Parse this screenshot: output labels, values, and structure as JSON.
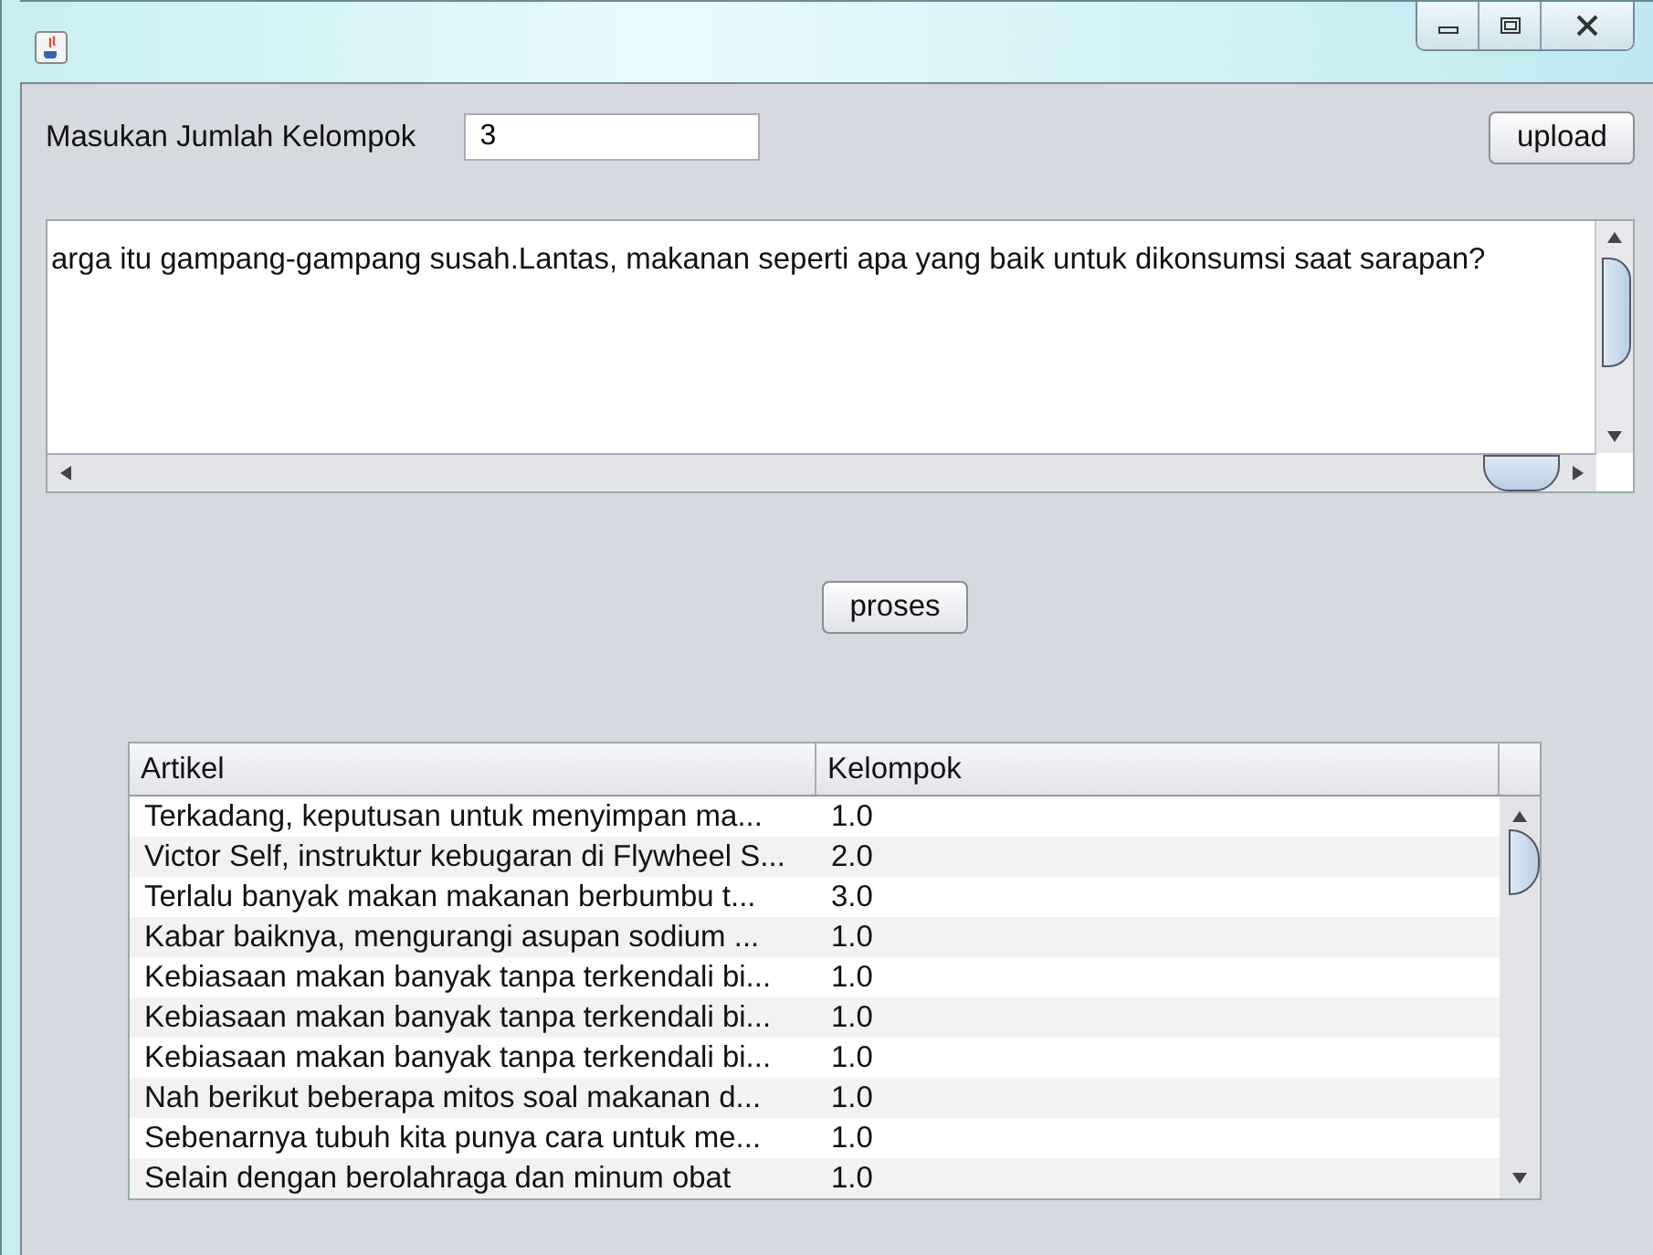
{
  "form": {
    "label": "Masukan Jumlah Kelompok",
    "value": "3",
    "upload_button": "upload"
  },
  "text_area": {
    "value": "arga itu gampang-gampang susah.Lantas, makanan seperti apa yang baik untuk dikonsumsi saat sarapan?"
  },
  "process_button": "proses",
  "table": {
    "columns": [
      "Artikel",
      "Kelompok"
    ],
    "rows": [
      {
        "artikel": "Terkadang, keputusan untuk menyimpan ma...",
        "kelompok": "1.0"
      },
      {
        "artikel": "Victor Self, instruktur kebugaran di Flywheel S...",
        "kelompok": "2.0"
      },
      {
        "artikel": "Terlalu banyak makan makanan berbumbu t...",
        "kelompok": "3.0"
      },
      {
        "artikel": "Kabar baiknya, mengurangi asupan sodium ...",
        "kelompok": "1.0"
      },
      {
        "artikel": "Kebiasaan makan banyak tanpa terkendali bi...",
        "kelompok": "1.0"
      },
      {
        "artikel": "Kebiasaan makan banyak tanpa terkendali bi...",
        "kelompok": "1.0"
      },
      {
        "artikel": "Kebiasaan makan banyak tanpa terkendali bi...",
        "kelompok": "1.0"
      },
      {
        "artikel": "Nah berikut beberapa mitos soal makanan d...",
        "kelompok": "1.0"
      },
      {
        "artikel": "Sebenarnya tubuh kita punya cara untuk me...",
        "kelompok": "1.0"
      },
      {
        "artikel": "Selain dengan berolahraga dan minum obat",
        "kelompok": "1.0"
      }
    ]
  }
}
